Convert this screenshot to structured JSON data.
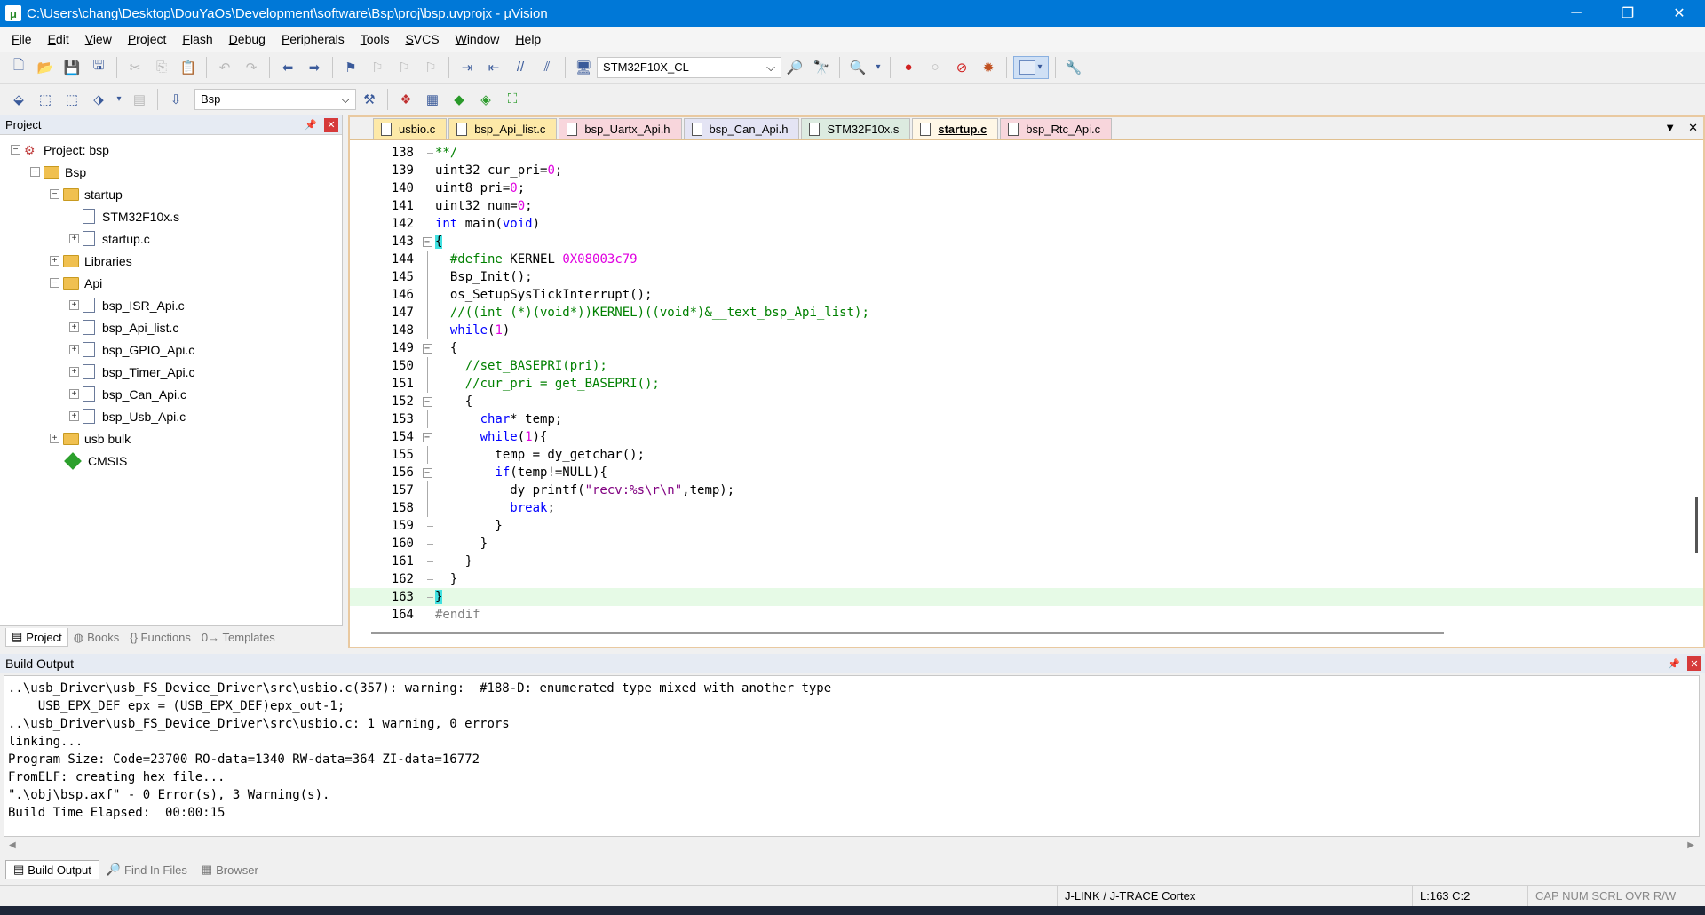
{
  "window": {
    "title": "C:\\Users\\chang\\Desktop\\DouYaOs\\Development\\software\\Bsp\\proj\\bsp.uvprojx - µVision",
    "icon": "keil-icon"
  },
  "menu": [
    "File",
    "Edit",
    "View",
    "Project",
    "Flash",
    "Debug",
    "Peripherals",
    "Tools",
    "SVCS",
    "Window",
    "Help"
  ],
  "toolbar": {
    "device": "STM32F10X_CL",
    "target": "Bsp"
  },
  "project_panel": {
    "title": "Project",
    "tree": [
      {
        "label": "Project: bsp",
        "level": 0,
        "toggle": "−",
        "icon": "project-icon"
      },
      {
        "label": "Bsp",
        "level": 1,
        "toggle": "−",
        "icon": "folder-icon"
      },
      {
        "label": "startup",
        "level": 2,
        "toggle": "−",
        "icon": "folder-icon"
      },
      {
        "label": "STM32F10x.s",
        "level": 3,
        "toggle": "",
        "icon": "file-icon"
      },
      {
        "label": "startup.c",
        "level": 3,
        "toggle": "+",
        "icon": "file-icon"
      },
      {
        "label": "Libraries",
        "level": 2,
        "toggle": "+",
        "icon": "folder-icon"
      },
      {
        "label": "Api",
        "level": 2,
        "toggle": "−",
        "icon": "folder-icon"
      },
      {
        "label": "bsp_ISR_Api.c",
        "level": 3,
        "toggle": "+",
        "icon": "file-icon"
      },
      {
        "label": "bsp_Api_list.c",
        "level": 3,
        "toggle": "+",
        "icon": "file-icon"
      },
      {
        "label": "bsp_GPIO_Api.c",
        "level": 3,
        "toggle": "+",
        "icon": "file-icon"
      },
      {
        "label": "bsp_Timer_Api.c",
        "level": 3,
        "toggle": "+",
        "icon": "file-icon"
      },
      {
        "label": "bsp_Can_Api.c",
        "level": 3,
        "toggle": "+",
        "icon": "file-icon"
      },
      {
        "label": "bsp_Usb_Api.c",
        "level": 3,
        "toggle": "+",
        "icon": "file-icon"
      },
      {
        "label": "usb bulk",
        "level": 2,
        "toggle": "+",
        "icon": "folder-icon"
      },
      {
        "label": "CMSIS",
        "level": 2,
        "toggle": "",
        "icon": "cmsis-icon"
      }
    ],
    "tabs": [
      "Project",
      "Books",
      "{} Functions",
      "0→ Templates"
    ]
  },
  "editor": {
    "tabs": [
      {
        "label": "usbio.c",
        "color": "c-y"
      },
      {
        "label": "bsp_Api_list.c",
        "color": "c-y"
      },
      {
        "label": "bsp_Uartx_Api.h",
        "color": "c-p"
      },
      {
        "label": "bsp_Can_Api.h",
        "color": "c-l"
      },
      {
        "label": "STM32F10x.s",
        "color": "c-g"
      },
      {
        "label": "startup.c",
        "color": "act"
      },
      {
        "label": "bsp_Rtc_Api.c",
        "color": "c-p"
      }
    ],
    "lines": [
      {
        "n": "138",
        "g": "end",
        "t": "**/"
      },
      {
        "n": "139",
        "g": "",
        "t": "uint32 cur_pri=0;"
      },
      {
        "n": "140",
        "g": "",
        "t": "uint8 pri=0;"
      },
      {
        "n": "141",
        "g": "",
        "t": "uint32 num=0;"
      },
      {
        "n": "142",
        "g": "",
        "t": "int main(void)"
      },
      {
        "n": "143",
        "g": "box",
        "t": "{"
      },
      {
        "n": "144",
        "g": "line",
        "t": "  #define KERNEL 0X08003c79"
      },
      {
        "n": "145",
        "g": "line",
        "t": "  Bsp_Init();"
      },
      {
        "n": "146",
        "g": "line",
        "t": "  os_SetupSysTickInterrupt();"
      },
      {
        "n": "147",
        "g": "line",
        "t": "  //((int (*)(void*))KERNEL)((void*)&__text_bsp_Api_list);"
      },
      {
        "n": "148",
        "g": "line",
        "t": "  while(1)"
      },
      {
        "n": "149",
        "g": "box",
        "t": "  {"
      },
      {
        "n": "150",
        "g": "line",
        "t": "    //set_BASEPRI(pri);"
      },
      {
        "n": "151",
        "g": "line",
        "t": "    //cur_pri = get_BASEPRI();"
      },
      {
        "n": "152",
        "g": "box",
        "t": "    {"
      },
      {
        "n": "153",
        "g": "line",
        "t": "      char* temp;"
      },
      {
        "n": "154",
        "g": "box",
        "t": "      while(1){"
      },
      {
        "n": "155",
        "g": "line",
        "t": "        temp = dy_getchar();"
      },
      {
        "n": "156",
        "g": "box",
        "t": "        if(temp!=NULL){"
      },
      {
        "n": "157",
        "g": "line",
        "t": "          dy_printf(\"recv:%s\\r\\n\",temp);"
      },
      {
        "n": "158",
        "g": "line",
        "t": "          break;"
      },
      {
        "n": "159",
        "g": "end",
        "t": "        }"
      },
      {
        "n": "160",
        "g": "end",
        "t": "      }"
      },
      {
        "n": "161",
        "g": "end",
        "t": "    }"
      },
      {
        "n": "162",
        "g": "end",
        "t": "  }"
      },
      {
        "n": "163",
        "g": "end",
        "t": "}"
      },
      {
        "n": "164",
        "g": "",
        "t": "#endif"
      }
    ]
  },
  "build": {
    "title": "Build Output",
    "lines": [
      "..\\usb_Driver\\usb_FS_Device_Driver\\src\\usbio.c(357): warning:  #188-D: enumerated type mixed with another type",
      "    USB_EPX_DEF epx = (USB_EPX_DEF)epx_out-1;",
      "..\\usb_Driver\\usb_FS_Device_Driver\\src\\usbio.c: 1 warning, 0 errors",
      "linking...",
      "Program Size: Code=23700 RO-data=1340 RW-data=364 ZI-data=16772",
      "FromELF: creating hex file...",
      "\".\\obj\\bsp.axf\" - 0 Error(s), 3 Warning(s).",
      "Build Time Elapsed:  00:00:15"
    ],
    "tabs": [
      "Build Output",
      "Find In Files",
      "Browser"
    ]
  },
  "status": {
    "debugger": "J-LINK / J-TRACE Cortex",
    "position": "L:163 C:2",
    "flags": "CAP  NUM  SCRL  OVR  R/W"
  }
}
